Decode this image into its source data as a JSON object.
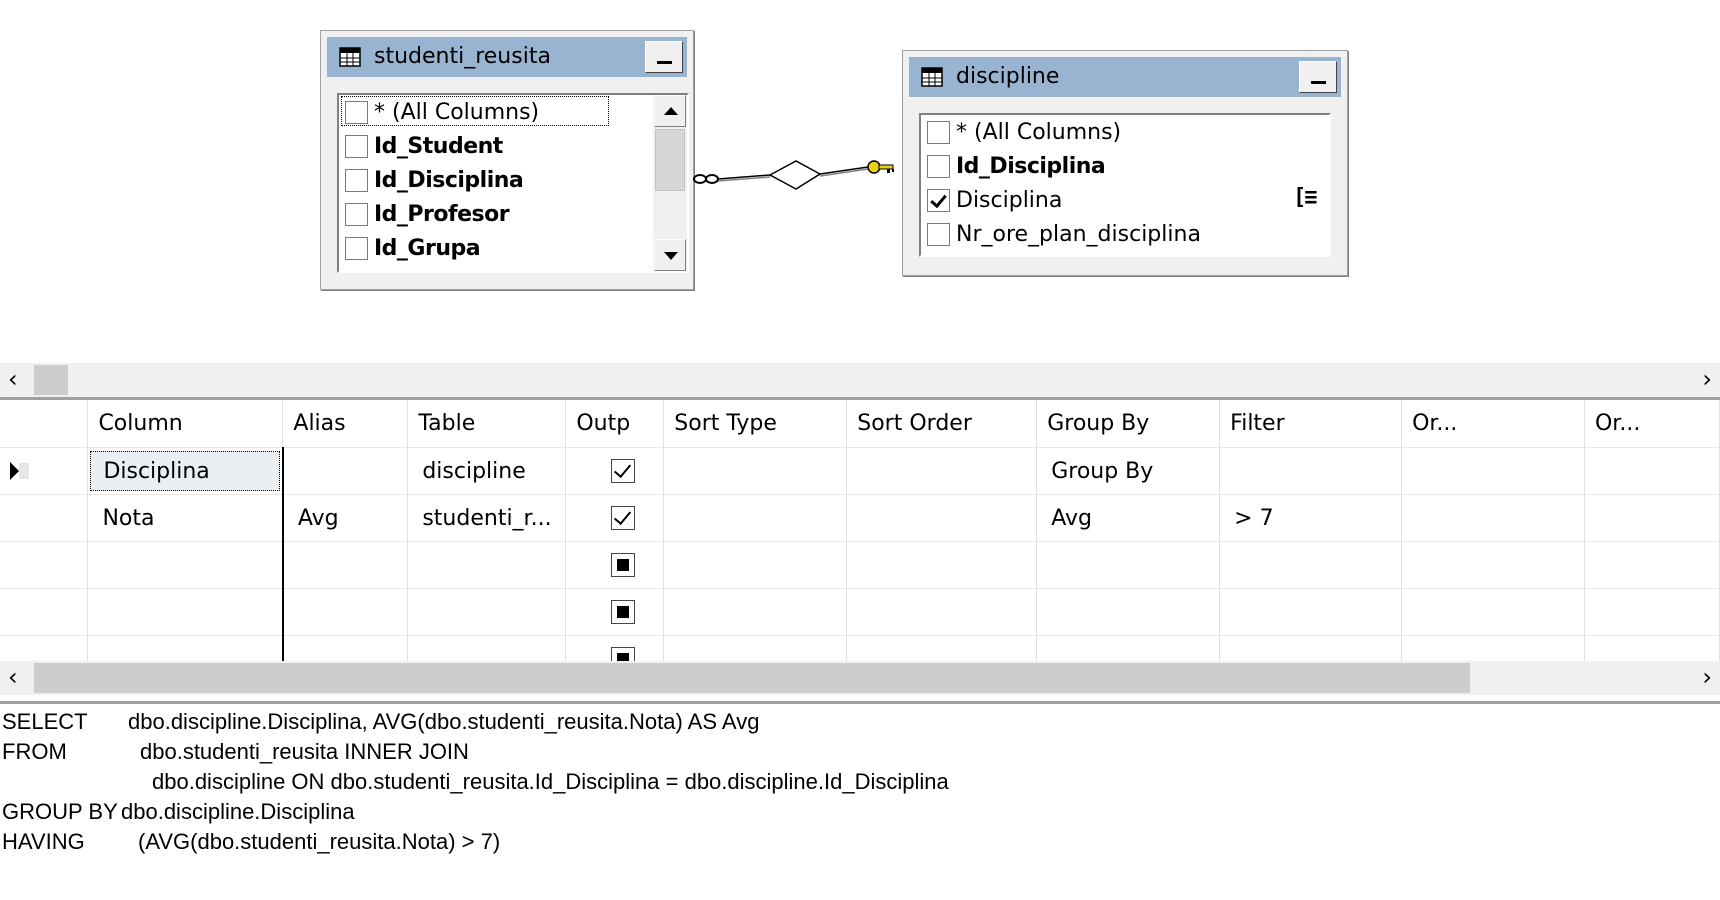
{
  "diagram": {
    "tables": [
      {
        "title": "studenti_reusita",
        "columns": [
          {
            "label": "* (All Columns)",
            "bold": false,
            "checked": false
          },
          {
            "label": "Id_Student",
            "bold": true,
            "checked": false
          },
          {
            "label": "Id_Disciplina",
            "bold": true,
            "checked": false
          },
          {
            "label": "Id_Profesor",
            "bold": true,
            "checked": false
          },
          {
            "label": "Id_Grupa",
            "bold": true,
            "checked": false
          }
        ]
      },
      {
        "title": "discipline",
        "columns": [
          {
            "label": "* (All Columns)",
            "bold": false,
            "checked": false
          },
          {
            "label": "Id_Disciplina",
            "bold": true,
            "checked": false
          },
          {
            "label": "Disciplina",
            "bold": false,
            "checked": true
          },
          {
            "label": "Nr_ore_plan_disciplina",
            "bold": false,
            "checked": false
          }
        ]
      }
    ],
    "filter_icon_glyph": "[≡"
  },
  "grid": {
    "headers": [
      "Column",
      "Alias",
      "Table",
      "Outp",
      "Sort Type",
      "Sort Order",
      "Group By",
      "Filter",
      "Or...",
      "Or..."
    ],
    "rows": [
      {
        "column": "Disciplina",
        "alias": "",
        "table": "discipline",
        "output": "checked",
        "sort_type": "",
        "sort_order": "",
        "group_by": "Group By",
        "filter": "",
        "or1": "",
        "or2": ""
      },
      {
        "column": "Nota",
        "alias": "Avg",
        "table": "studenti_r...",
        "output": "checked",
        "sort_type": "",
        "sort_order": "",
        "group_by": "Avg",
        "filter": "> 7",
        "or1": "",
        "or2": ""
      },
      {
        "column": "",
        "alias": "",
        "table": "",
        "output": "indeterminate",
        "sort_type": "",
        "sort_order": "",
        "group_by": "",
        "filter": "",
        "or1": "",
        "or2": ""
      },
      {
        "column": "",
        "alias": "",
        "table": "",
        "output": "indeterminate",
        "sort_type": "",
        "sort_order": "",
        "group_by": "",
        "filter": "",
        "or1": "",
        "or2": ""
      },
      {
        "column": "",
        "alias": "",
        "table": "",
        "output": "indeterminate",
        "sort_type": "",
        "sort_order": "",
        "group_by": "",
        "filter": "",
        "or1": "",
        "or2": ""
      }
    ]
  },
  "sql": {
    "lines": [
      {
        "keyword": "SELECT",
        "text": "dbo.discipline.Disciplina, AVG(dbo.studenti_reusita.Nota) AS Avg"
      },
      {
        "keyword": "FROM",
        "text": "dbo.studenti_reusita INNER JOIN"
      },
      {
        "keyword": "",
        "text": "dbo.discipline ON dbo.studenti_reusita.Id_Disciplina = dbo.discipline.Id_Disciplina"
      },
      {
        "keyword": "GROUP BY",
        "text": "dbo.discipline.Disciplina"
      },
      {
        "keyword": "HAVING",
        "text": "(AVG(dbo.studenti_reusita.Nota) > 7)"
      }
    ]
  },
  "icons": {
    "scroll_left": "‹",
    "scroll_right": "›"
  }
}
